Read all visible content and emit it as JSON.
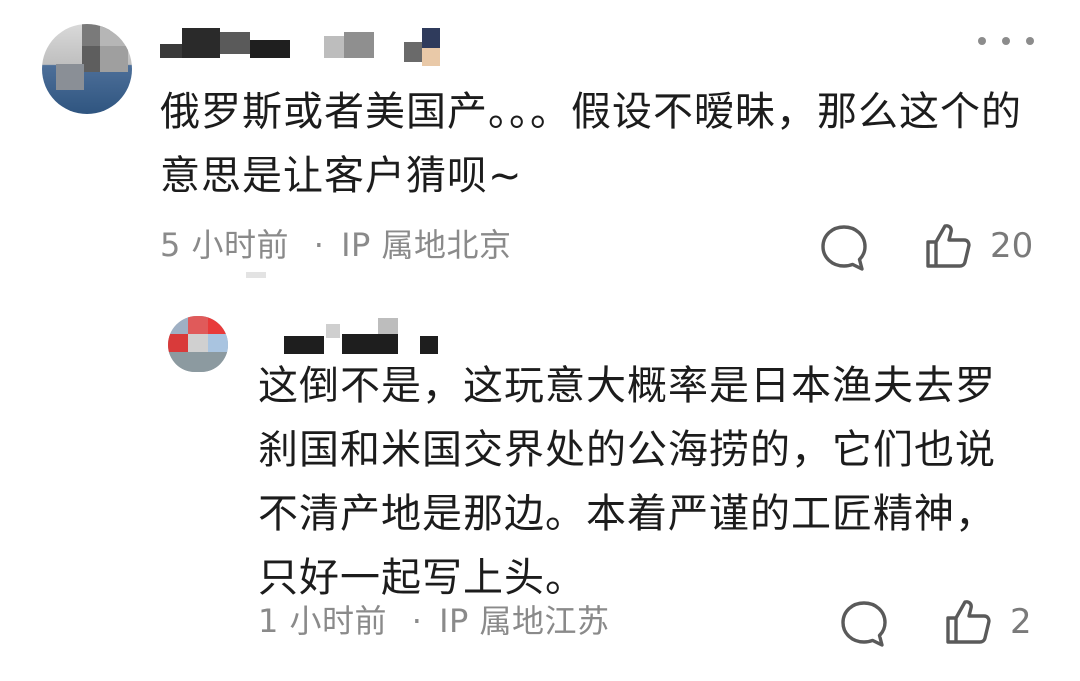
{
  "comments": [
    {
      "text": "俄罗斯或者美国产。。。假设不暧昧，那么这个的意思是让客户猜呗~",
      "time": "5 小时前",
      "separator": "·",
      "location": "IP 属地北京",
      "likes": "20"
    }
  ],
  "reply": {
    "text": "这倒不是，这玩意大概率是日本渔夫去罗刹国和米国交界处的公海捞的，它们也说不清产地是那边。本着严谨的工匠精神，只好一起写上头。",
    "time": "1 小时前",
    "separator": "·",
    "location": "IP 属地江苏",
    "likes": "2"
  },
  "icons": {
    "more": "more-dots-icon",
    "reply": "comment-bubble-icon",
    "like": "thumbs-up-icon"
  },
  "colors": {
    "text": "#1c1c1c",
    "meta": "#8a8a8a",
    "icon": "#5a5a5a"
  }
}
